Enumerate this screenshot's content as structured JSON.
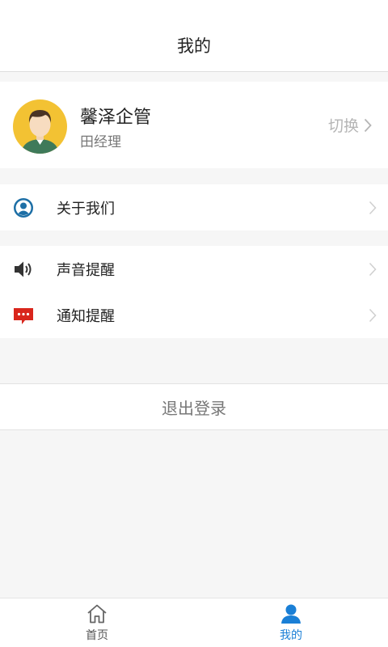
{
  "header": {
    "title": "我的"
  },
  "profile": {
    "name": "馨泽企管",
    "role": "田经理",
    "switch_label": "切换"
  },
  "menu": {
    "about": {
      "label": "关于我们",
      "icon": "user-circle-icon"
    },
    "sound": {
      "label": "声音提醒",
      "icon": "speaker-icon"
    },
    "notify": {
      "label": "通知提醒",
      "icon": "message-icon"
    }
  },
  "logout": {
    "label": "退出登录"
  },
  "tabs": [
    {
      "label": "首页",
      "icon": "home-icon",
      "active": false
    },
    {
      "label": "我的",
      "icon": "person-icon",
      "active": true
    }
  ],
  "colors": {
    "accent": "#1a7fd6",
    "notify_red": "#d9261c",
    "avatar_bg": "#f3c233"
  }
}
